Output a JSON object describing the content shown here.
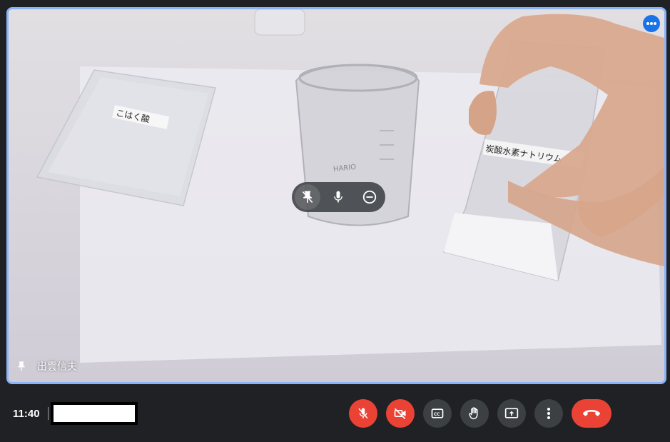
{
  "tile": {
    "participant_name": "出雲信夫",
    "bag_label_left": "こはく酸",
    "bag_label_right": "炭酸水素ナトリウム",
    "beaker_text": "HARIO"
  },
  "toolbar": {
    "time": "11:40",
    "meeting_code": ""
  },
  "icons": {
    "tile_more": "more-horiz-icon",
    "pin": "pin-icon",
    "unpin": "unpin-icon",
    "mic": "mic-icon",
    "remove": "remove-circle-icon",
    "mic_off": "mic-off-icon",
    "camera_off": "videocam-off-icon",
    "captions": "closed-caption-icon",
    "raise_hand": "raise-hand-icon",
    "present": "present-screen-icon",
    "more": "more-vert-icon",
    "leave": "call-end-icon"
  },
  "colors": {
    "background": "#202124",
    "tile_border": "#8ab4f8",
    "danger": "#ea4335",
    "control": "#3c4043",
    "accent": "#1a73e8"
  }
}
